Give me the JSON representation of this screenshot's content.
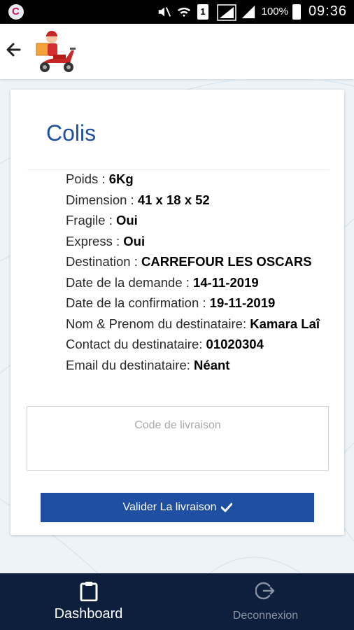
{
  "status_bar": {
    "sim_slot": "1",
    "battery": "100%",
    "time": "09:36"
  },
  "card": {
    "title": "Colis",
    "details": [
      {
        "label": "Poids : ",
        "value": "6Kg"
      },
      {
        "label": "Dimension : ",
        "value": "41 x 18 x 52"
      },
      {
        "label": "Fragile : ",
        "value": "Oui"
      },
      {
        "label": "Express : ",
        "value": "Oui"
      },
      {
        "label": "Destination : ",
        "value": "CARREFOUR LES OSCARS"
      },
      {
        "label": "Date de la demande : ",
        "value": "14-11-2019"
      },
      {
        "label": "Date de la confirmation : ",
        "value": "19-11-2019"
      },
      {
        "label": "Nom & Prenom du destinataire: ",
        "value": "Kamara Laî"
      },
      {
        "label": "Contact du destinataire: ",
        "value": "01020304"
      },
      {
        "label": "Email du destinataire: ",
        "value": "Néant"
      }
    ],
    "code_field": {
      "placeholder": "Code de livraison",
      "value": ""
    },
    "validate_button": {
      "label": "Valider La livraison",
      "icon": "check-icon"
    }
  },
  "bottom_nav": {
    "items": [
      {
        "label": "Dashboard",
        "icon": "clipboard-icon",
        "active": true
      },
      {
        "label": "Deconnexion",
        "icon": "logout-icon",
        "active": false
      }
    ]
  },
  "colors": {
    "primary": "#1e4fa3",
    "nav_background": "#0d1f3d",
    "nav_active": "#ffffff",
    "nav_inactive": "#8b93a3"
  }
}
